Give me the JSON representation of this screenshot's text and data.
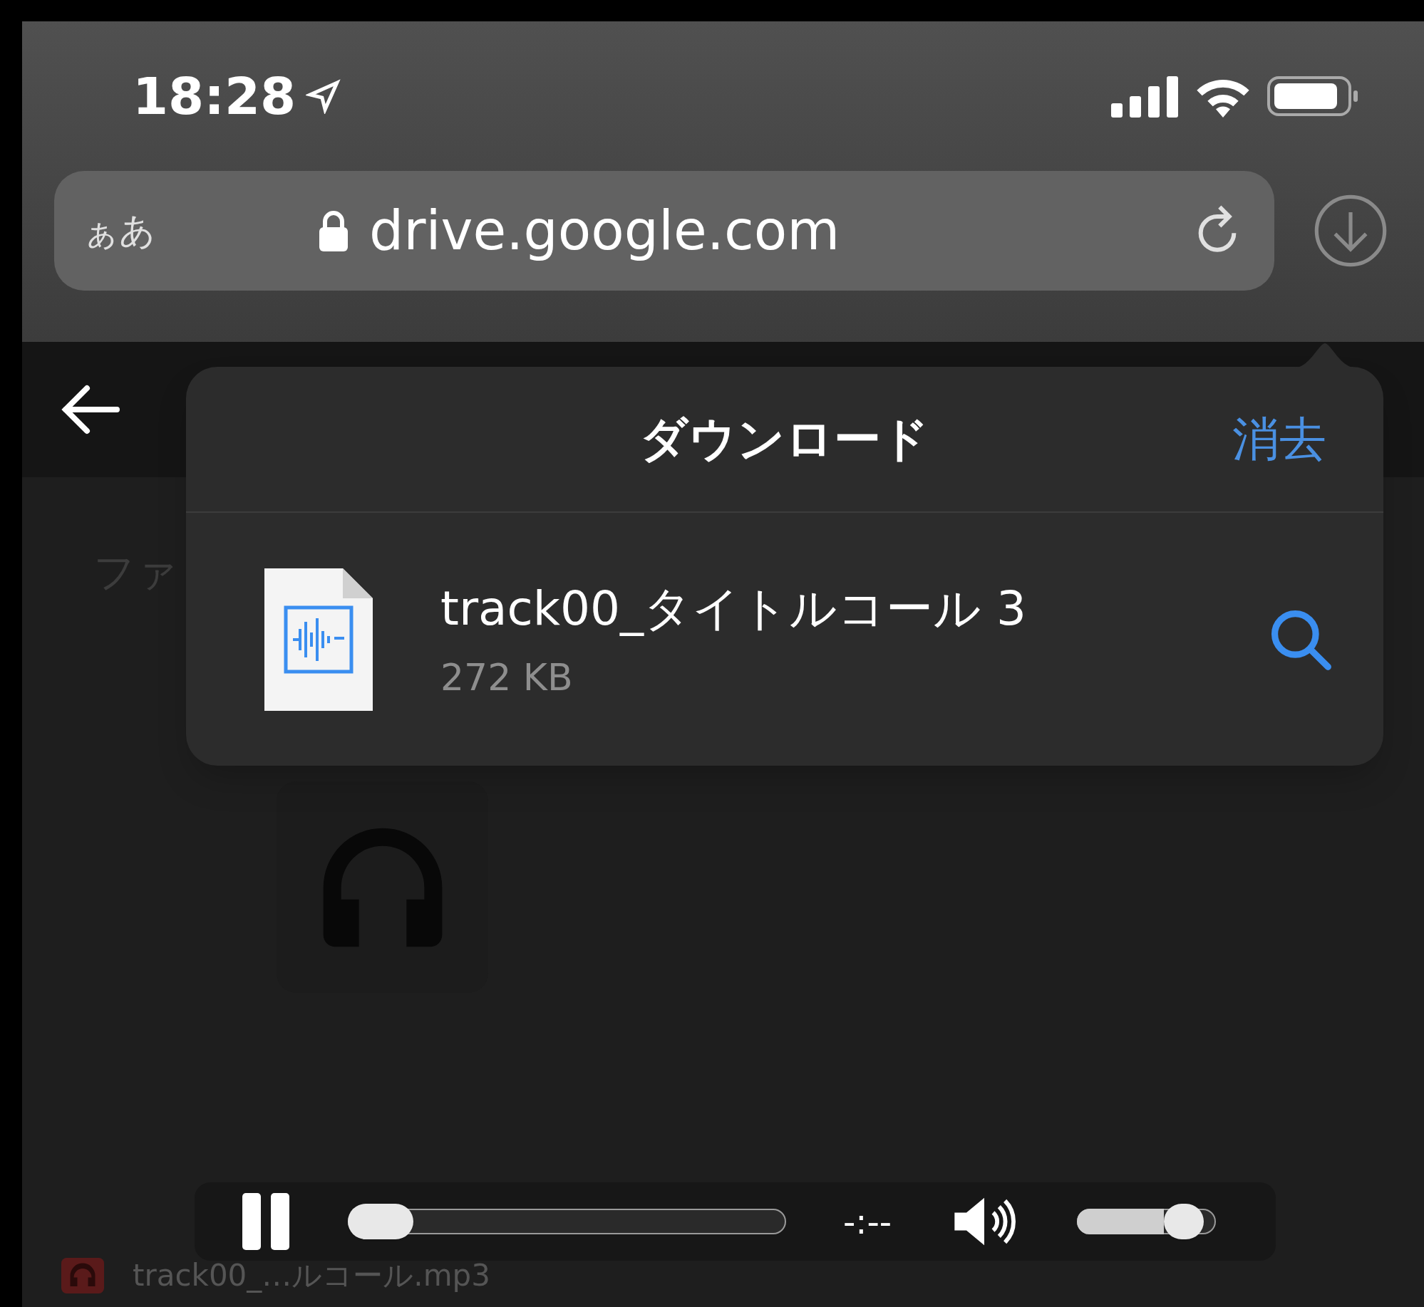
{
  "status_bar": {
    "time": "18:28"
  },
  "address_bar": {
    "text_size_button": "ぁあ",
    "url": "drive.google.com"
  },
  "page": {
    "partial_label": "ファ",
    "file_row": {
      "name": "track00_…ルコール.mp3"
    }
  },
  "downloads_popover": {
    "title": "ダウンロード",
    "clear_button": "消去",
    "items": [
      {
        "name": "track00_タイトルコール 3",
        "size": "272 KB"
      }
    ]
  },
  "player": {
    "playing": true,
    "position": {
      "level": 0
    },
    "time": "-:--",
    "volume": {
      "level": 0.88
    }
  }
}
